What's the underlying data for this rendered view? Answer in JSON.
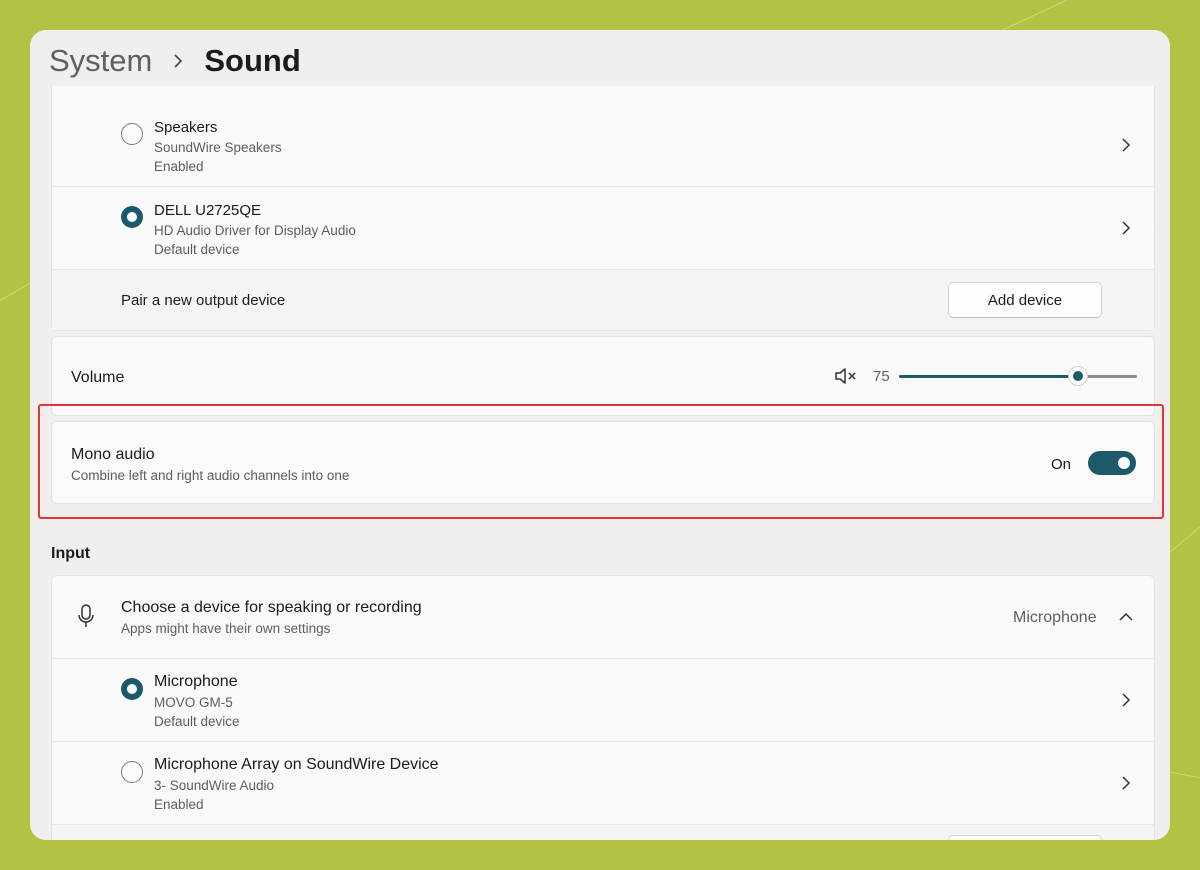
{
  "breadcrumb": {
    "parent": "System",
    "current": "Sound"
  },
  "output_devices": [
    {
      "name": "Speakers",
      "driver": "SoundWire Speakers",
      "status": "Enabled",
      "selected": false
    },
    {
      "name": "DELL U2725QE",
      "driver": "HD Audio Driver for Display Audio",
      "status": "Default device",
      "selected": true
    }
  ],
  "pair_output": {
    "label": "Pair a new output device",
    "button": "Add device"
  },
  "volume": {
    "label": "Volume",
    "value": "75",
    "level": 0.75,
    "mute_icon": "speaker-mute-icon"
  },
  "mono_audio": {
    "title": "Mono audio",
    "description": "Combine left and right audio channels into one",
    "state": "On",
    "enabled": true
  },
  "input": {
    "section_title": "Input",
    "chooser": {
      "title": "Choose a device for speaking or recording",
      "subtitle": "Apps might have their own settings",
      "selected": "Microphone",
      "icon": "microphone-icon"
    },
    "devices": [
      {
        "name": "Microphone",
        "driver": "MOVO GM-5",
        "status": "Default device",
        "selected": true
      },
      {
        "name": "Microphone Array on SoundWire Device",
        "driver": "3- SoundWire Audio",
        "status": "Enabled",
        "selected": false
      }
    ]
  },
  "colors": {
    "accent": "#1c5a6b",
    "highlight": "#e0353b",
    "background": "#b3c244"
  }
}
